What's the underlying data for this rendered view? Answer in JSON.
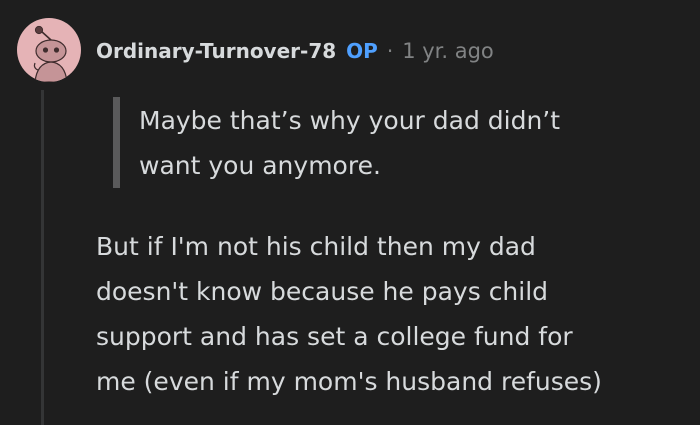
{
  "comment": {
    "author": "Ordinary-Turnover-78",
    "op_badge": "OP",
    "separator": "·",
    "timestamp": "1 yr. ago",
    "quote_lines": [
      "Maybe that’s why your dad didn’t",
      "want you anymore."
    ],
    "body_lines": [
      "But if I'm not his child then my dad",
      "doesn't know because he pays child",
      "support and has set a college fund for",
      "me (even if my mom's husband refuses)"
    ]
  },
  "colors": {
    "background": "#1e1e1e",
    "text": "#d7dadc",
    "meta": "#818384",
    "op": "#4fa0ff",
    "avatar_bg": "#e5b3b6"
  },
  "icons": {
    "avatar": "snoo-avatar-icon"
  }
}
